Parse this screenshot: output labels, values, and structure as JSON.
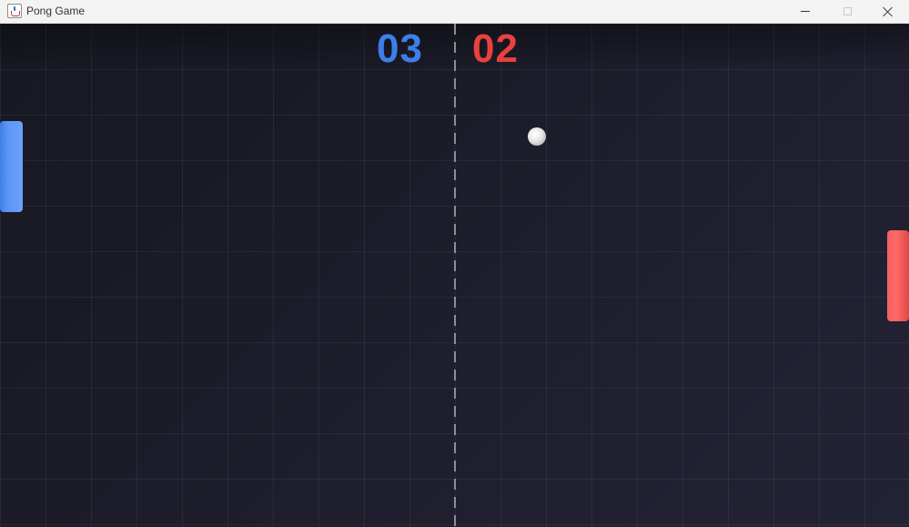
{
  "window": {
    "title": "Pong Game",
    "icon": "java-cup-icon"
  },
  "title_bar_buttons": [
    "minimize",
    "maximize",
    "close"
  ],
  "scoreboard": {
    "left_score": "03",
    "right_score": "02",
    "left_color": "#3d7eea",
    "right_color": "#e8413f"
  },
  "colors": {
    "background": "#1a1a24",
    "left_paddle": "#5b95f5",
    "right_paddle": "#ff6868",
    "ball": "#e6e6e6",
    "center_line": "#8d8d96"
  }
}
